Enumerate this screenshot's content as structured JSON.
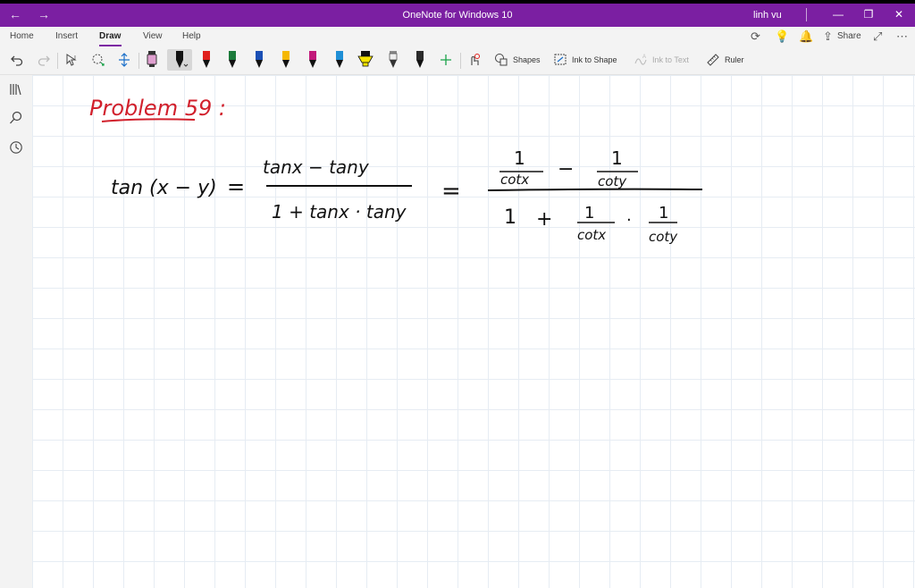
{
  "window": {
    "title": "OneNote for Windows 10",
    "user": "linh vu"
  },
  "ribbon": {
    "tabs": [
      "Home",
      "Insert",
      "Draw",
      "View",
      "Help"
    ],
    "active_tab": "Draw",
    "share_label": "Share",
    "tools": {
      "shapes_label": "Shapes",
      "ink_to_shape_label": "Ink to Shape",
      "ink_to_text_label": "Ink to Text",
      "ruler_label": "Ruler"
    },
    "pens": [
      {
        "color": "#e0a0d0",
        "kind": "highlighter"
      },
      {
        "color": "#111111",
        "kind": "pen-selected"
      },
      {
        "color": "#e0201c",
        "kind": "pen"
      },
      {
        "color": "#1b7a3a",
        "kind": "pen"
      },
      {
        "color": "#1a4fb5",
        "kind": "pen"
      },
      {
        "color": "#f5b800",
        "kind": "pen"
      },
      {
        "color": "#c2187a",
        "kind": "pen"
      },
      {
        "color": "#1f8fd6",
        "kind": "pen"
      },
      {
        "color": "#f5e400",
        "kind": "highlighter"
      },
      {
        "color": "#8a8a8a",
        "kind": "pencil"
      },
      {
        "color": "#2a2a2a",
        "kind": "pen"
      }
    ]
  },
  "page": {
    "problem_heading": "Problem 59 :",
    "lhs": "tan (x − y)",
    "eq": "=",
    "frac1_num": "tanx − tany",
    "frac1_den": "1 + tanx · tany",
    "big_num_a_top": "1",
    "big_num_a_bot": "cotx",
    "minus": "−",
    "big_num_b_top": "1",
    "big_num_b_bot": "coty",
    "den_one": "1",
    "plus": "+",
    "den_c_top": "1",
    "den_c_bot": "cotx",
    "dot": "·",
    "den_d_top": "1",
    "den_d_bot": "coty"
  },
  "colors": {
    "accent": "#7b1fa2",
    "ink": "#111111",
    "heading_ink": "#d1202c"
  }
}
